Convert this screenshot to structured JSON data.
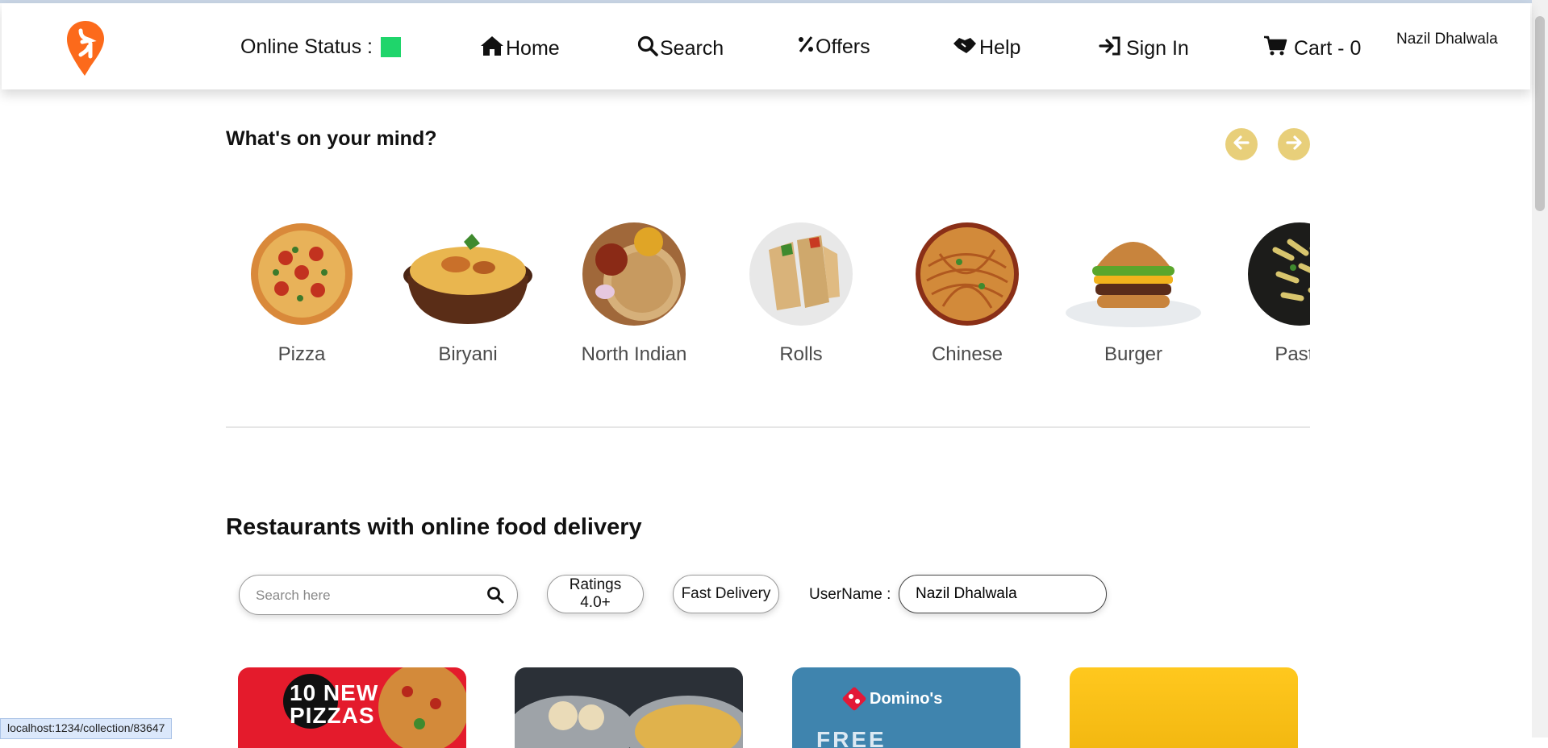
{
  "header": {
    "online_status_label": "Online Status :",
    "online_status_color": "#1fd56b",
    "nav": [
      {
        "label": "Home",
        "icon": "home-icon"
      },
      {
        "label": "Search",
        "icon": "search-icon"
      },
      {
        "label": "Offers",
        "icon": "percent-icon"
      },
      {
        "label": "Help",
        "icon": "handshake-icon"
      },
      {
        "label": "Sign In",
        "icon": "sign-in-icon"
      },
      {
        "label": "Cart - 0",
        "icon": "cart-icon"
      }
    ],
    "user_name": "Nazil Dhalwala"
  },
  "mind": {
    "title": "What's on your mind?",
    "prev_icon": "arrow-left-icon",
    "next_icon": "arrow-right-icon",
    "categories": [
      {
        "label": "Pizza"
      },
      {
        "label": "Biryani"
      },
      {
        "label": "North Indian"
      },
      {
        "label": "Rolls"
      },
      {
        "label": "Chinese"
      },
      {
        "label": "Burger"
      },
      {
        "label": "Pasta"
      }
    ]
  },
  "restaurants": {
    "title": "Restaurants with online food delivery",
    "search_placeholder": "Search here",
    "filters": [
      "Ratings 4.0+",
      "Fast Delivery"
    ],
    "username_label": "UserName :",
    "username_value": "Nazil Dhalwala",
    "cards": [
      {
        "text": "10 NEW PIZZAS",
        "color": "#e41b2c"
      },
      {
        "text": "",
        "color": "#2b3037"
      },
      {
        "text": "Domino's",
        "subtext": "FREE DELIVERY",
        "color": "#3f84ae"
      },
      {
        "text": "",
        "color": "#f7c21a"
      }
    ]
  },
  "status_bar": {
    "url": "localhost:1234/collection/83647"
  },
  "colors": {
    "brand": "#fc6a1b",
    "arrow": "#e8cf7a"
  }
}
